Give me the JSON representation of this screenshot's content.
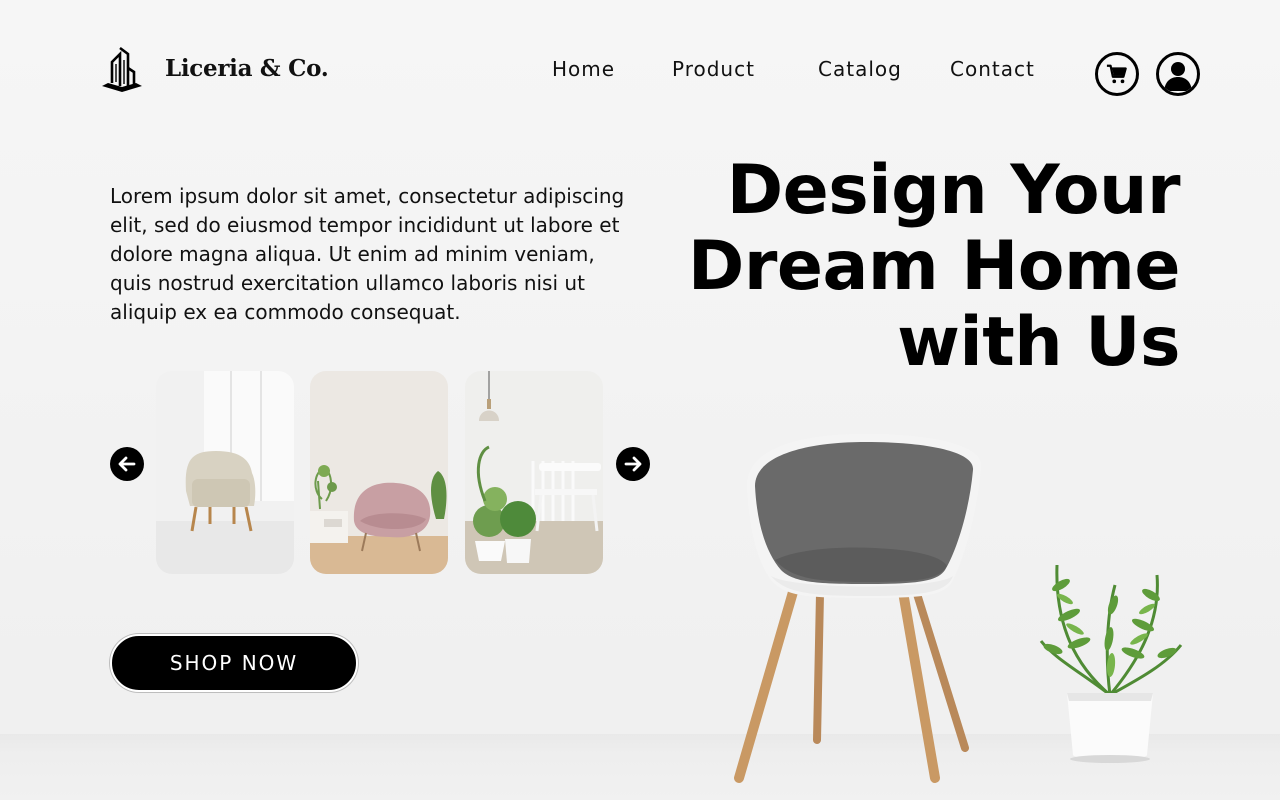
{
  "header": {
    "brand": "Liceria & Co.",
    "nav": {
      "home": "Home",
      "product": "Product",
      "catalog": "Catalog",
      "contact": "Contact"
    },
    "cart_icon": "cart-icon",
    "user_icon": "user-icon"
  },
  "hero": {
    "description": "Lorem ipsum dolor sit amet, consectetur adipiscing elit, sed do eiusmod tempor incididunt ut labore et dolore magna aliqua. Ut enim ad minim veniam, quis nostrud exercitation ullamco laboris nisi ut aliquip ex ea commodo consequat.",
    "headline": [
      "Design Your",
      "Dream Home",
      "with Us"
    ],
    "cta_label": "SHOP NOW"
  },
  "carousel": {
    "prev_icon": "arrow-left-icon",
    "next_icon": "arrow-right-icon",
    "items": [
      "beige-armchair-image",
      "pink-armchair-image",
      "white-chair-plants-image"
    ]
  },
  "colors": {
    "primary": "#000000",
    "background": "#f4f4f4",
    "text": "#111111"
  }
}
